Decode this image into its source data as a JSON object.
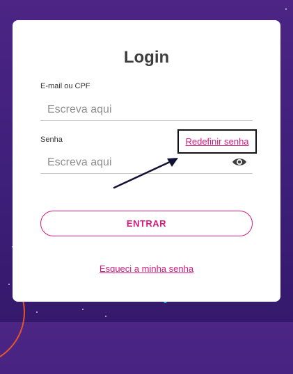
{
  "login": {
    "title": "Login",
    "email_label": "E-mail ou CPF",
    "email_placeholder": "Escreva aqui",
    "password_label": "Senha",
    "password_placeholder": "Escreva aqui",
    "reset_link": "Redefinir senha",
    "submit_label": "ENTRAR",
    "forgot_link": "Esqueci a minha senha"
  },
  "icons": {
    "password_toggle": "eye-icon"
  },
  "colors": {
    "accent": "#d6197e",
    "background": "#4a2483",
    "card": "#ffffff",
    "annotation": "#111133"
  }
}
